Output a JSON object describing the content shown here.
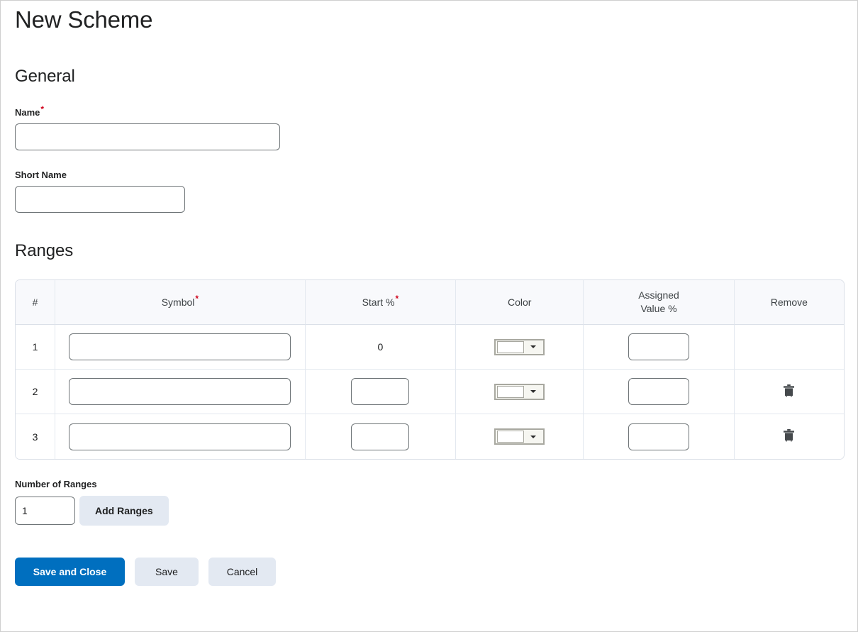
{
  "page": {
    "title": "New Scheme"
  },
  "general": {
    "heading": "General",
    "name_label": "Name",
    "name_required_marker": "*",
    "name_value": "",
    "short_name_label": "Short Name",
    "short_name_value": ""
  },
  "ranges": {
    "heading": "Ranges",
    "columns": [
      {
        "key": "num",
        "label": "#",
        "required": false
      },
      {
        "key": "symbol",
        "label": "Symbol",
        "required": true
      },
      {
        "key": "start",
        "label": "Start %",
        "required": true
      },
      {
        "key": "color",
        "label": "Color",
        "required": false
      },
      {
        "key": "value",
        "label": "Assigned\nValue %",
        "label_line1": "Assigned",
        "label_line2": "Value %",
        "required": false
      },
      {
        "key": "remove",
        "label": "Remove",
        "required": false
      }
    ],
    "required_marker": "*",
    "rows": [
      {
        "num": "1",
        "symbol_value": "",
        "start_static": "0",
        "start_editable": false,
        "color_value": "#ffffff",
        "assigned_value": "",
        "removable": false,
        "remove_icon": "trash-icon"
      },
      {
        "num": "2",
        "symbol_value": "",
        "start_static": "",
        "start_editable": true,
        "color_value": "#ffffff",
        "assigned_value": "",
        "removable": true,
        "remove_icon": "trash-icon"
      },
      {
        "num": "3",
        "symbol_value": "",
        "start_static": "",
        "start_editable": true,
        "color_value": "#ffffff",
        "assigned_value": "",
        "removable": true,
        "remove_icon": "trash-icon"
      }
    ],
    "number_of_ranges_label": "Number of Ranges",
    "number_of_ranges_value": "1",
    "add_ranges_label": "Add Ranges"
  },
  "actions": {
    "save_and_close_label": "Save and Close",
    "save_label": "Save",
    "cancel_label": "Cancel"
  },
  "colors": {
    "primary_button": "#006fbf",
    "secondary_button": "#e3e9f2",
    "required_asterisk": "#d0021b",
    "table_header_bg": "#f8f9fc",
    "table_border": "#dbe0e8",
    "page_border": "#cfcfcf",
    "text": "#202122",
    "input_border": "#6e7477",
    "trash_icon": "#45494c"
  }
}
